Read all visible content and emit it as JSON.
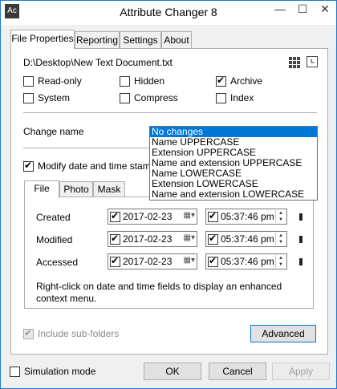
{
  "window": {
    "title": "Attribute Changer 8",
    "icon_text": "Ac",
    "controls": {
      "min": "—",
      "max": "☐",
      "close": "✕"
    }
  },
  "tabs": [
    {
      "label": "File Properties",
      "active": true
    },
    {
      "label": "Reporting",
      "active": false
    },
    {
      "label": "Settings",
      "active": false
    },
    {
      "label": "About",
      "active": false
    }
  ],
  "file_path": "D:\\Desktop\\New Text Document.txt",
  "attributes": [
    {
      "label": "Read-only",
      "checked": false
    },
    {
      "label": "Hidden",
      "checked": false
    },
    {
      "label": "Archive",
      "checked": true
    },
    {
      "label": "System",
      "checked": false
    },
    {
      "label": "Compress",
      "checked": false
    },
    {
      "label": "Index",
      "checked": false
    }
  ],
  "change_name": {
    "label": "Change name",
    "options": [
      "No changes",
      "Name UPPERCASE",
      "Extension UPPERCASE",
      "Name and extension UPPERCASE",
      "Name LOWERCASE",
      "Extension LOWERCASE",
      "Name and extension LOWERCASE"
    ],
    "selected_index": 0
  },
  "modify_dates": {
    "label": "Modify date and time stamps",
    "checked": true
  },
  "inner_tabs": [
    {
      "label": "File",
      "active": true
    },
    {
      "label": "Photo",
      "active": false
    },
    {
      "label": "Mask",
      "active": false
    }
  ],
  "date_rows": [
    {
      "label": "Created",
      "date": "2017-02-23",
      "time": "05:37:46 pm"
    },
    {
      "label": "Modified",
      "date": "2017-02-23",
      "time": "05:37:46 pm"
    },
    {
      "label": "Accessed",
      "date": "2017-02-23",
      "time": "05:37:46 pm"
    }
  ],
  "help_text": "Right-click on date and time fields to display an enhanced context menu.",
  "include_subfolders": {
    "label": "Include sub-folders",
    "checked": true,
    "disabled": true
  },
  "advanced_button": "Advanced",
  "simulation_mode": {
    "label": "Simulation mode",
    "checked": false
  },
  "buttons": {
    "ok": "OK",
    "cancel": "Cancel",
    "apply": "Apply"
  },
  "colors": {
    "accent": "#0078d7",
    "window_border": "#1e7ad6"
  }
}
